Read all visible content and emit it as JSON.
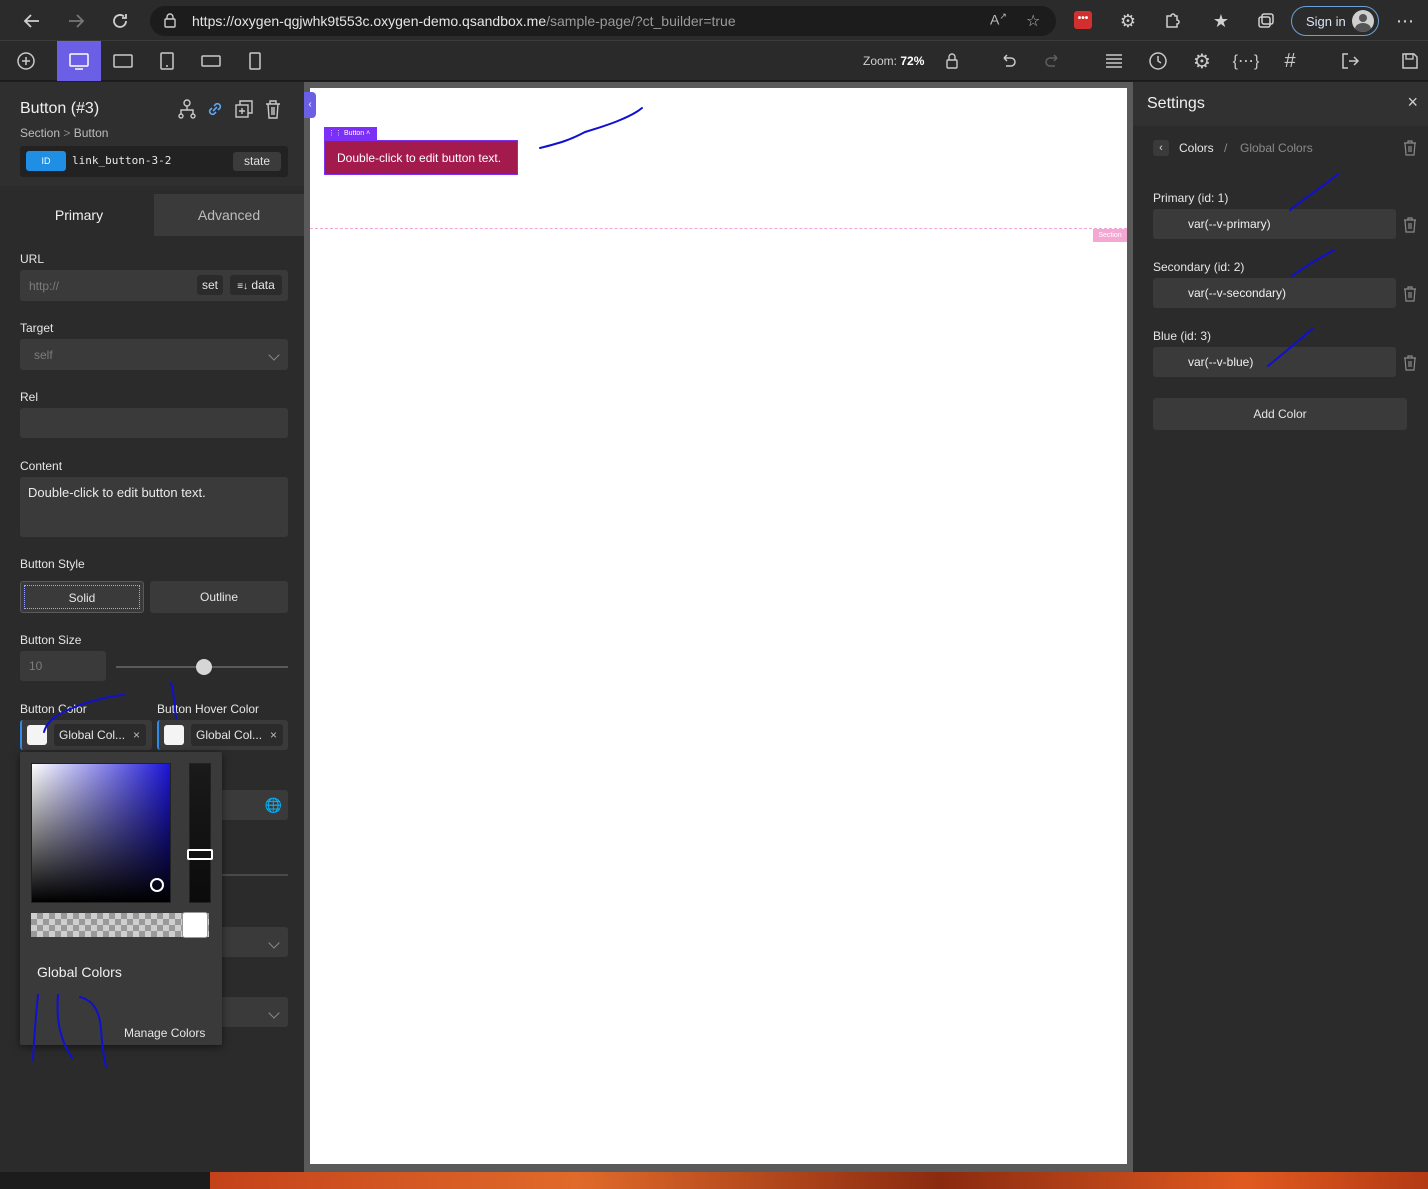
{
  "browser": {
    "url_main": "https://oxygen-qgjwhk9t553c.oxygen-demo.qsandbox.me",
    "url_path": "/sample-page/?ct_builder=true",
    "signin_label": "Sign in",
    "ext_badge": "•••"
  },
  "toolbar": {
    "zoom_label": "Zoom:",
    "zoom_value": "72%"
  },
  "left_panel": {
    "title": "Button (#3)",
    "breadcrumb_parent": "Section",
    "breadcrumb_sep": ">",
    "breadcrumb_current": "Button",
    "id_badge": "ID",
    "id_value": "link_button-3-2",
    "state_label": "state",
    "tabs": [
      {
        "label": "Primary"
      },
      {
        "label": "Advanced"
      }
    ],
    "url_label": "URL",
    "url_placeholder": "http://",
    "url_set": "set",
    "url_data": "data",
    "target_label": "Target",
    "target_value": "self",
    "rel_label": "Rel",
    "content_label": "Content",
    "content_value": "Double-click to edit button text.",
    "style_label": "Button Style",
    "style_solid": "Solid",
    "style_outline": "Outline",
    "size_label": "Button Size",
    "size_value": "10",
    "size_fraction": 0.51,
    "color_label": "Button Color",
    "hover_label": "Button Hover Color",
    "color_chip": "Global Col...",
    "hover_chip": "Global Col...",
    "chip_close": "×"
  },
  "picker": {
    "global_colors_label": "Global Colors",
    "manage_colors_label": "Manage Colors",
    "hue_color": "#1a14d6"
  },
  "canvas": {
    "button_text": "Double-click to edit button text.",
    "button_tag": "Button",
    "section_tag": "Section",
    "button_color": "#a31a4c",
    "selection_color": "#7b2ff7"
  },
  "right_panel": {
    "title": "Settings",
    "close": "×",
    "crumb_colors": "Colors",
    "crumb_sep": "/",
    "crumb_global": "Global Colors",
    "colors": [
      {
        "name": "Primary (id: 1)",
        "value": "var(--v-primary)"
      },
      {
        "name": "Secondary (id: 2)",
        "value": "var(--v-secondary)"
      },
      {
        "name": "Blue (id: 3)",
        "value": "var(--v-blue)"
      }
    ],
    "add_color": "Add Color"
  }
}
